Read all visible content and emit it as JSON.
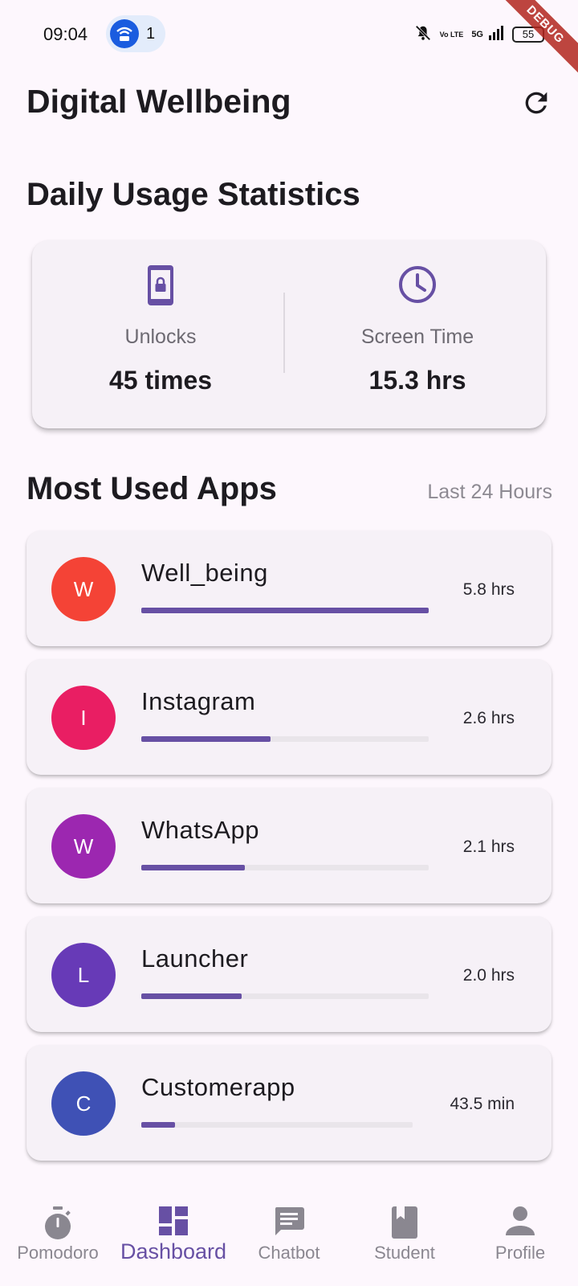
{
  "status_bar": {
    "time": "09:04",
    "hotspot_count": "1",
    "network_type": "5G",
    "volte": "Vo LTE",
    "battery": "55",
    "debug_banner": "DEBUG"
  },
  "header": {
    "title": "Digital Wellbeing",
    "refresh_icon": "refresh-icon"
  },
  "daily_stats": {
    "title": "Daily Usage Statistics",
    "unlocks": {
      "icon": "phone-lock-icon",
      "label": "Unlocks",
      "value": "45 times"
    },
    "screen_time": {
      "icon": "clock-icon",
      "label": "Screen Time",
      "value": "15.3 hrs"
    }
  },
  "most_used": {
    "title": "Most Used Apps",
    "subtitle": "Last 24 Hours",
    "apps": [
      {
        "initial": "W",
        "name": "Well_being",
        "time": "5.8 hrs",
        "usage_fraction": 1.0,
        "color": "#f44336"
      },
      {
        "initial": "I",
        "name": "Instagram",
        "time": "2.6 hrs",
        "usage_fraction": 0.45,
        "color": "#e91e63"
      },
      {
        "initial": "W",
        "name": "WhatsApp",
        "time": "2.1 hrs",
        "usage_fraction": 0.36,
        "color": "#9c27b0"
      },
      {
        "initial": "L",
        "name": "Launcher",
        "time": "2.0 hrs",
        "usage_fraction": 0.35,
        "color": "#673ab7"
      },
      {
        "initial": "C",
        "name": "Customerapp",
        "time": "43.5 min",
        "usage_fraction": 0.125,
        "color": "#3f51b5"
      }
    ]
  },
  "bottom_nav": {
    "items": [
      {
        "label": "Pomodoro",
        "icon": "stopwatch-icon",
        "active": false
      },
      {
        "label": "Dashboard",
        "icon": "dashboard-icon",
        "active": true
      },
      {
        "label": "Chatbot",
        "icon": "chat-icon",
        "active": false
      },
      {
        "label": "Student",
        "icon": "book-icon",
        "active": false
      },
      {
        "label": "Profile",
        "icon": "person-icon",
        "active": false
      }
    ]
  },
  "colors": {
    "accent": "#6750a4",
    "background": "#fdf7fd",
    "card": "#f6f1f7"
  }
}
